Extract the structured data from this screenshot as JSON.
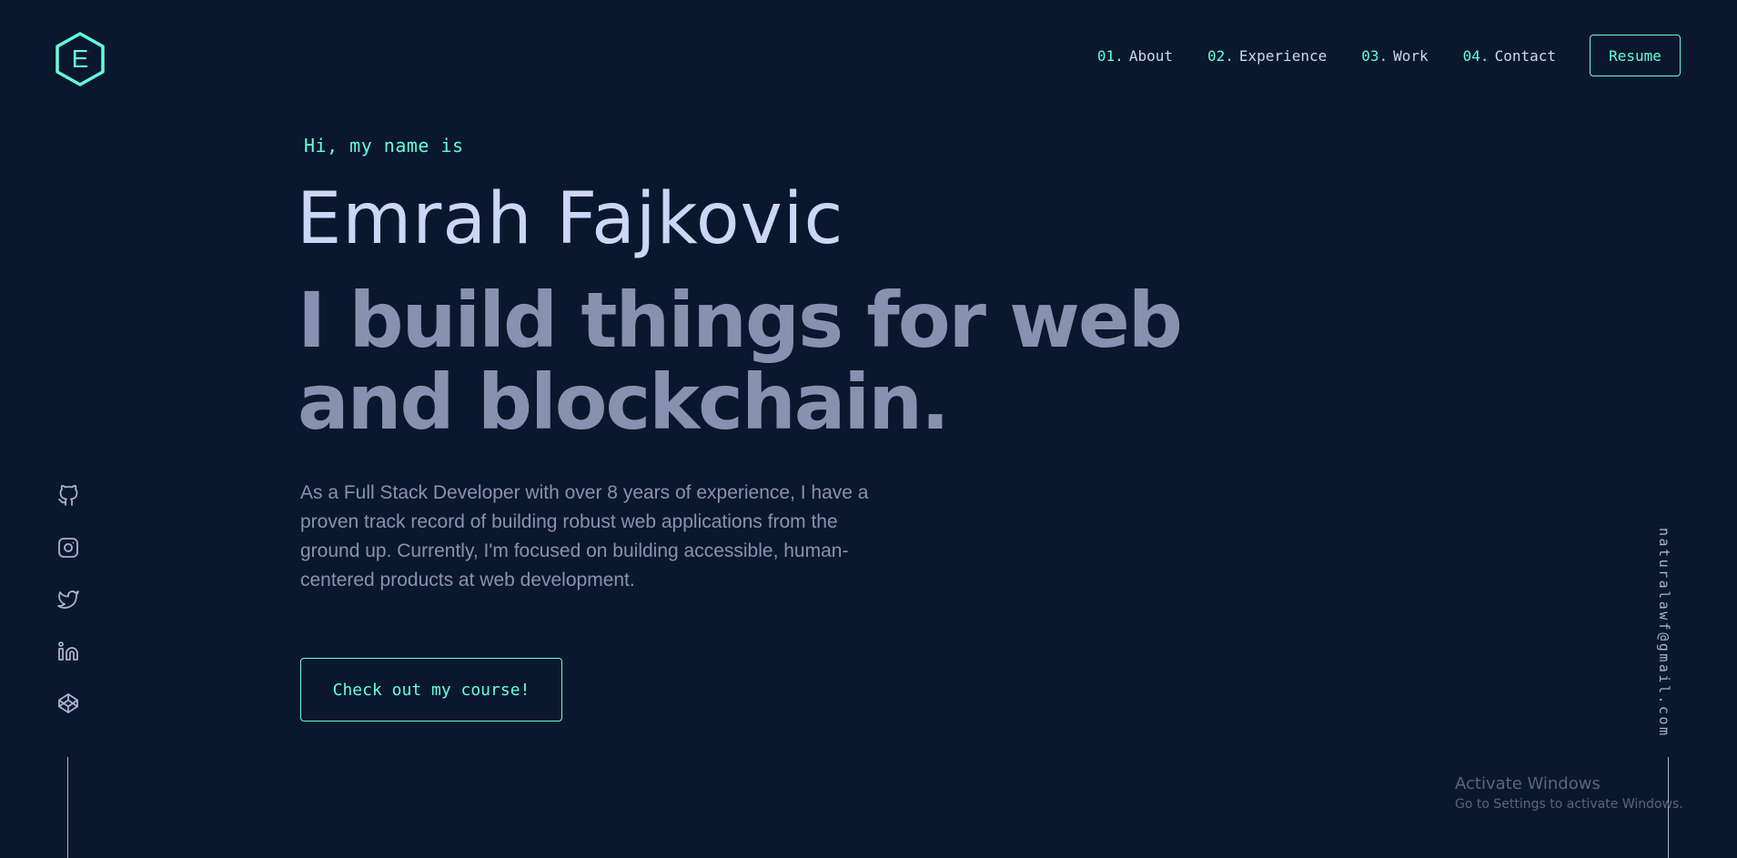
{
  "header": {
    "logo_letter": "E",
    "nav": [
      {
        "num": "01.",
        "label": "About"
      },
      {
        "num": "02.",
        "label": "Experience"
      },
      {
        "num": "03.",
        "label": "Work"
      },
      {
        "num": "04.",
        "label": "Contact"
      }
    ],
    "resume_label": "Resume"
  },
  "hero": {
    "greeting": "Hi, my name is",
    "name": "Emrah Fajkovic",
    "tagline": "I build things for web and blockchain.",
    "description": "As a Full Stack Developer with over 8 years of experience, I have a proven track record of building robust web applications from the ground up. Currently, I'm focused on building accessible, human-centered products at web development.",
    "cta_label": "Check out my course!"
  },
  "social": {
    "icons": [
      "github-icon",
      "instagram-icon",
      "twitter-icon",
      "linkedin-icon",
      "codepen-icon"
    ]
  },
  "email": "naturalawf@gmail.com",
  "watermark": {
    "title": "Activate Windows",
    "subtitle": "Go to Settings to activate Windows."
  },
  "colors": {
    "background": "#0b172e",
    "accent": "#64ffda",
    "heading": "#ccd6f6",
    "body_text": "#8892b0"
  }
}
